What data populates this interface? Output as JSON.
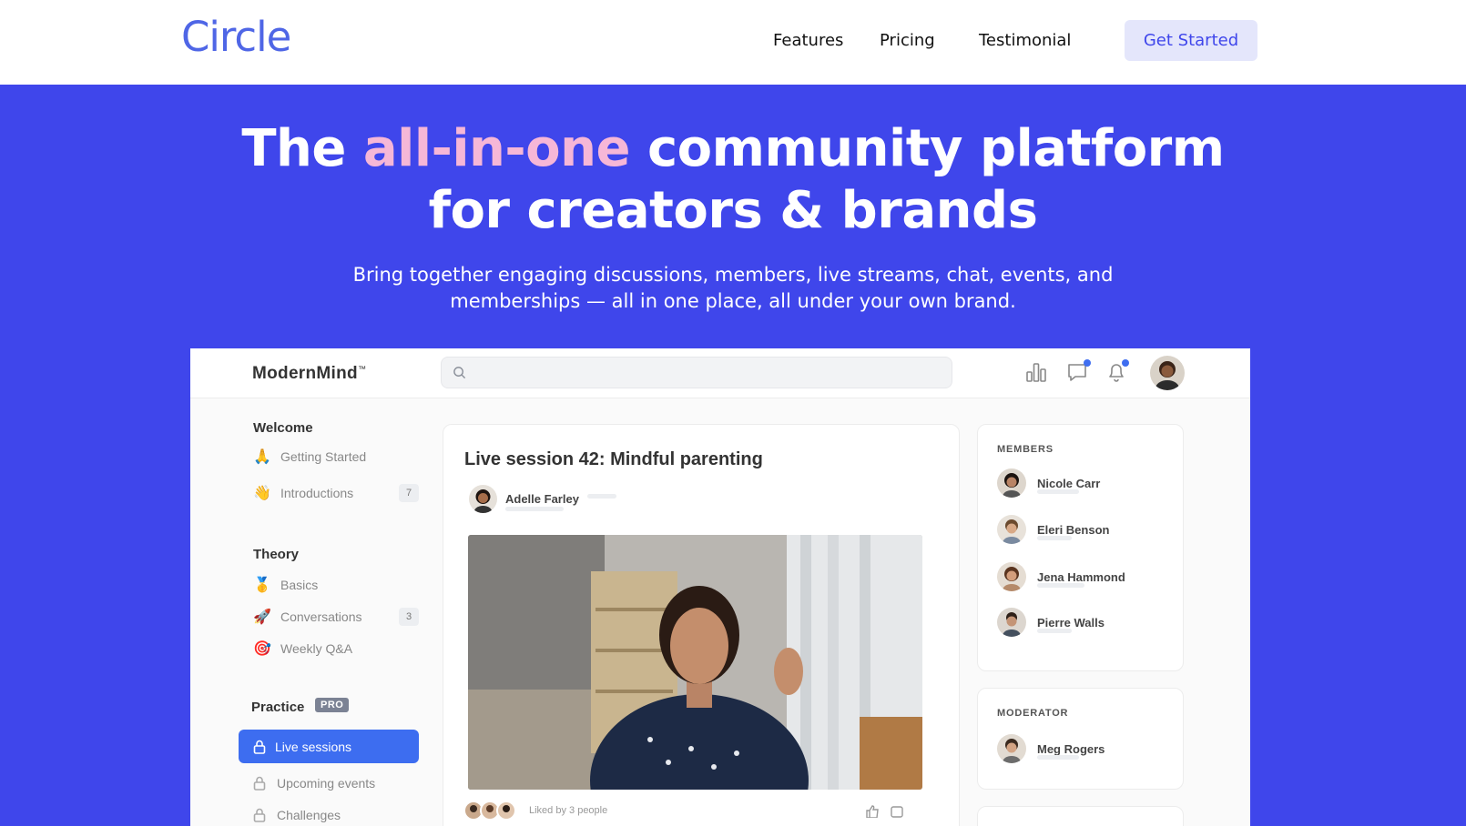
{
  "nav": {
    "logo": "Circle",
    "links": [
      "Features",
      "Pricing",
      "Testimonial"
    ],
    "cta": "Get Started"
  },
  "hero": {
    "title_start": "The",
    "title_highlight": "all-in-one",
    "title_rest": "community platform",
    "title_line2": "for creators & brands",
    "subtitle_line1": "Bring together engaging discussions, members, live streams, chat, events, and",
    "subtitle_line2": "memberships — all in one place, all under your own brand.",
    "highlight_color": "#f6b7d7",
    "accent_color": "#3f46eb"
  },
  "app": {
    "brand": "ModernMind",
    "brand_mark": "™",
    "search": {
      "placeholder": ""
    },
    "header_icons": [
      "analytics-icon",
      "chat-icon",
      "bell-icon"
    ],
    "sidebar": {
      "sections": [
        {
          "title": "Welcome",
          "items": [
            {
              "emoji": "🙏",
              "label": "Getting Started",
              "count": ""
            },
            {
              "emoji": "👋",
              "label": "Introductions",
              "count": "7"
            }
          ]
        },
        {
          "title": "Theory",
          "items": [
            {
              "emoji": "🥇",
              "label": "Basics",
              "count": ""
            },
            {
              "emoji": "🚀",
              "label": "Conversations",
              "count": "3"
            },
            {
              "emoji": "🎯",
              "label": "Weekly Q&A",
              "count": ""
            }
          ]
        },
        {
          "title": "Practice",
          "badge": "PRO",
          "items": [
            {
              "label": "Live sessions",
              "active": true
            },
            {
              "label": "Upcoming events"
            },
            {
              "label": "Challenges"
            }
          ]
        }
      ]
    },
    "post": {
      "title": "Live session 42: Mindful parenting",
      "author": "Adelle Farley",
      "likes_text": "Liked by 3 people"
    },
    "members_panel": {
      "title": "MEMBERS",
      "members": [
        "Nicole Carr",
        "Eleri Benson",
        "Jena Hammond",
        "Pierre Walls"
      ]
    },
    "moderator_panel": {
      "title": "MODERATOR",
      "members": [
        "Meg Rogers"
      ]
    },
    "active_color": "#3d6df0"
  }
}
